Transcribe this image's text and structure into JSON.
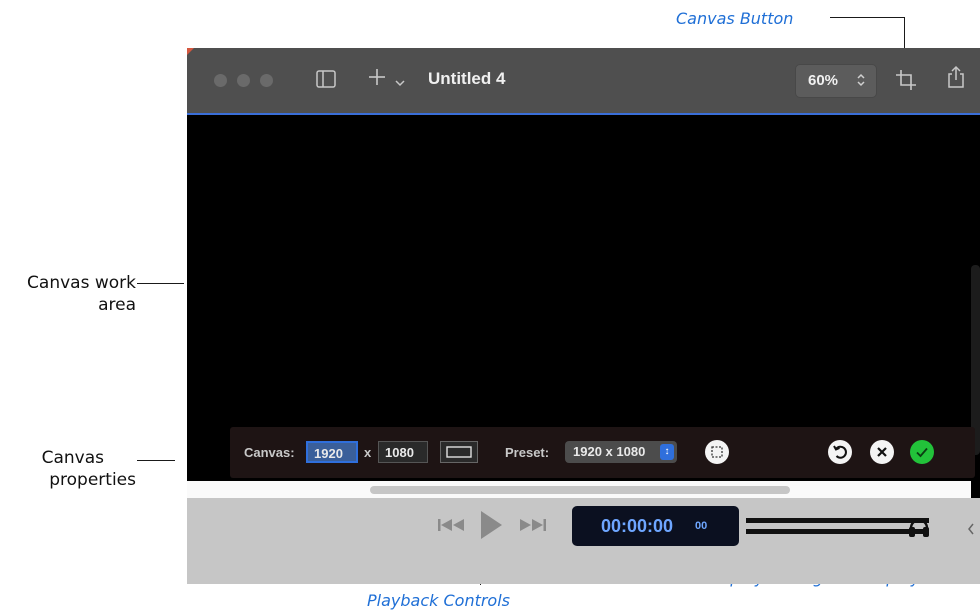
{
  "callouts": {
    "canvas_button": "Canvas Button",
    "canvas_work_area_line1": "Canvas work",
    "canvas_work_area_line2": "area",
    "canvas_properties_line1": "Canvas",
    "canvas_properties_line2": "properties",
    "playback_controls": "Playback Controls",
    "timecode_display": "Timecode Display & Progress Display"
  },
  "window": {
    "title": "Untitled 4",
    "zoom": "60%",
    "icons": [
      "sidebar-toggle-icon",
      "plus-icon",
      "chevron-down-icon",
      "crop-icon",
      "share-icon"
    ]
  },
  "canvas_properties": {
    "canvas_label": "Canvas:",
    "width": "1920",
    "times": "x",
    "height": "1080",
    "preset_label": "Preset:",
    "preset_value": "1920 x 1080",
    "icons": [
      "aspect-rectangle-icon",
      "crop-select-icon",
      "reset-icon",
      "cancel-icon",
      "confirm-icon"
    ],
    "colors": {
      "confirm": "#22c23a",
      "active_field": "#2f6fdc"
    }
  },
  "transport": {
    "timecode": "00:00:00",
    "frames": "00",
    "icons": [
      "skip-back-icon",
      "play-icon",
      "skip-forward-icon",
      "headphones-icon",
      "chevron-left-icon"
    ]
  }
}
